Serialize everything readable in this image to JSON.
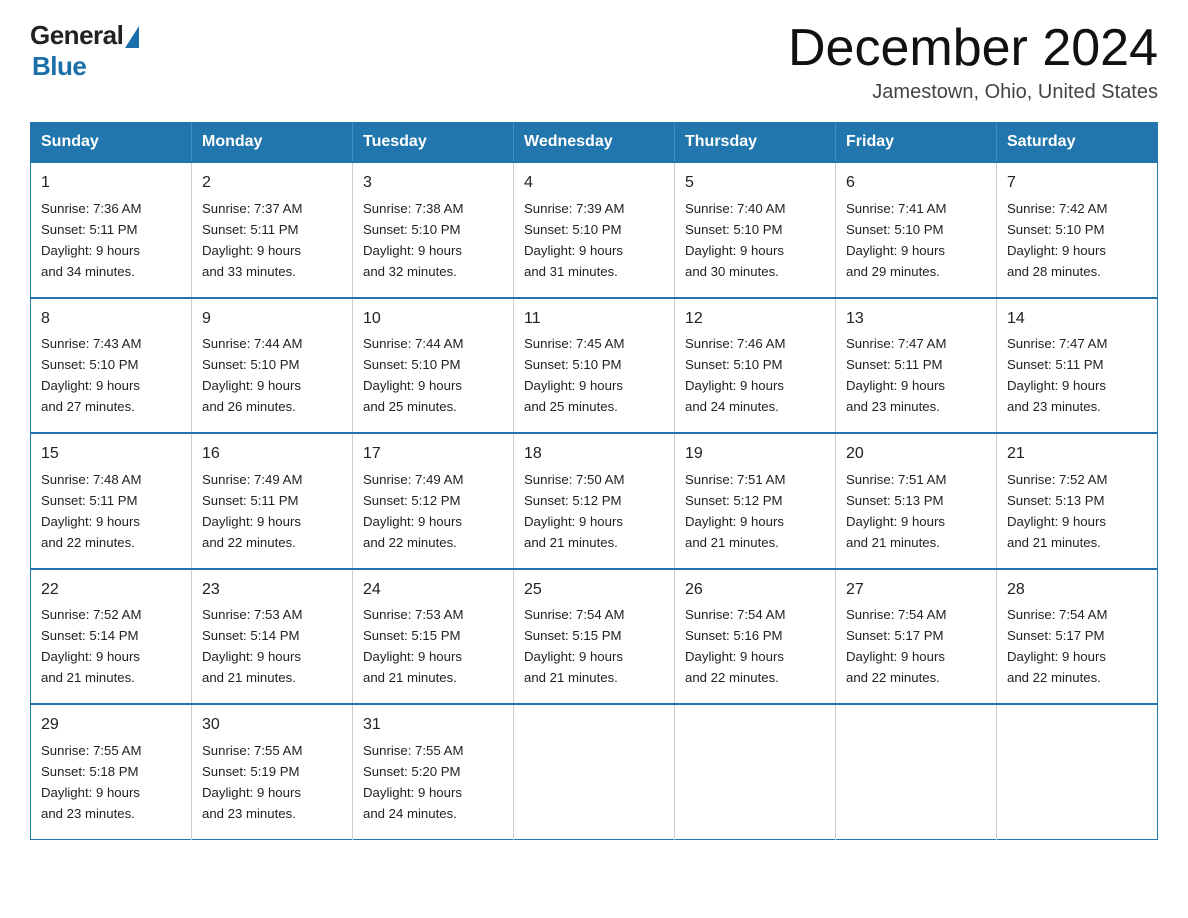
{
  "logo": {
    "general": "General",
    "blue": "Blue"
  },
  "header": {
    "month_title": "December 2024",
    "location": "Jamestown, Ohio, United States"
  },
  "days_of_week": [
    "Sunday",
    "Monday",
    "Tuesday",
    "Wednesday",
    "Thursday",
    "Friday",
    "Saturday"
  ],
  "weeks": [
    [
      {
        "day": "1",
        "sunrise": "7:36 AM",
        "sunset": "5:11 PM",
        "daylight": "9 hours and 34 minutes."
      },
      {
        "day": "2",
        "sunrise": "7:37 AM",
        "sunset": "5:11 PM",
        "daylight": "9 hours and 33 minutes."
      },
      {
        "day": "3",
        "sunrise": "7:38 AM",
        "sunset": "5:10 PM",
        "daylight": "9 hours and 32 minutes."
      },
      {
        "day": "4",
        "sunrise": "7:39 AM",
        "sunset": "5:10 PM",
        "daylight": "9 hours and 31 minutes."
      },
      {
        "day": "5",
        "sunrise": "7:40 AM",
        "sunset": "5:10 PM",
        "daylight": "9 hours and 30 minutes."
      },
      {
        "day": "6",
        "sunrise": "7:41 AM",
        "sunset": "5:10 PM",
        "daylight": "9 hours and 29 minutes."
      },
      {
        "day": "7",
        "sunrise": "7:42 AM",
        "sunset": "5:10 PM",
        "daylight": "9 hours and 28 minutes."
      }
    ],
    [
      {
        "day": "8",
        "sunrise": "7:43 AM",
        "sunset": "5:10 PM",
        "daylight": "9 hours and 27 minutes."
      },
      {
        "day": "9",
        "sunrise": "7:44 AM",
        "sunset": "5:10 PM",
        "daylight": "9 hours and 26 minutes."
      },
      {
        "day": "10",
        "sunrise": "7:44 AM",
        "sunset": "5:10 PM",
        "daylight": "9 hours and 25 minutes."
      },
      {
        "day": "11",
        "sunrise": "7:45 AM",
        "sunset": "5:10 PM",
        "daylight": "9 hours and 25 minutes."
      },
      {
        "day": "12",
        "sunrise": "7:46 AM",
        "sunset": "5:10 PM",
        "daylight": "9 hours and 24 minutes."
      },
      {
        "day": "13",
        "sunrise": "7:47 AM",
        "sunset": "5:11 PM",
        "daylight": "9 hours and 23 minutes."
      },
      {
        "day": "14",
        "sunrise": "7:47 AM",
        "sunset": "5:11 PM",
        "daylight": "9 hours and 23 minutes."
      }
    ],
    [
      {
        "day": "15",
        "sunrise": "7:48 AM",
        "sunset": "5:11 PM",
        "daylight": "9 hours and 22 minutes."
      },
      {
        "day": "16",
        "sunrise": "7:49 AM",
        "sunset": "5:11 PM",
        "daylight": "9 hours and 22 minutes."
      },
      {
        "day": "17",
        "sunrise": "7:49 AM",
        "sunset": "5:12 PM",
        "daylight": "9 hours and 22 minutes."
      },
      {
        "day": "18",
        "sunrise": "7:50 AM",
        "sunset": "5:12 PM",
        "daylight": "9 hours and 21 minutes."
      },
      {
        "day": "19",
        "sunrise": "7:51 AM",
        "sunset": "5:12 PM",
        "daylight": "9 hours and 21 minutes."
      },
      {
        "day": "20",
        "sunrise": "7:51 AM",
        "sunset": "5:13 PM",
        "daylight": "9 hours and 21 minutes."
      },
      {
        "day": "21",
        "sunrise": "7:52 AM",
        "sunset": "5:13 PM",
        "daylight": "9 hours and 21 minutes."
      }
    ],
    [
      {
        "day": "22",
        "sunrise": "7:52 AM",
        "sunset": "5:14 PM",
        "daylight": "9 hours and 21 minutes."
      },
      {
        "day": "23",
        "sunrise": "7:53 AM",
        "sunset": "5:14 PM",
        "daylight": "9 hours and 21 minutes."
      },
      {
        "day": "24",
        "sunrise": "7:53 AM",
        "sunset": "5:15 PM",
        "daylight": "9 hours and 21 minutes."
      },
      {
        "day": "25",
        "sunrise": "7:54 AM",
        "sunset": "5:15 PM",
        "daylight": "9 hours and 21 minutes."
      },
      {
        "day": "26",
        "sunrise": "7:54 AM",
        "sunset": "5:16 PM",
        "daylight": "9 hours and 22 minutes."
      },
      {
        "day": "27",
        "sunrise": "7:54 AM",
        "sunset": "5:17 PM",
        "daylight": "9 hours and 22 minutes."
      },
      {
        "day": "28",
        "sunrise": "7:54 AM",
        "sunset": "5:17 PM",
        "daylight": "9 hours and 22 minutes."
      }
    ],
    [
      {
        "day": "29",
        "sunrise": "7:55 AM",
        "sunset": "5:18 PM",
        "daylight": "9 hours and 23 minutes."
      },
      {
        "day": "30",
        "sunrise": "7:55 AM",
        "sunset": "5:19 PM",
        "daylight": "9 hours and 23 minutes."
      },
      {
        "day": "31",
        "sunrise": "7:55 AM",
        "sunset": "5:20 PM",
        "daylight": "9 hours and 24 minutes."
      },
      null,
      null,
      null,
      null
    ]
  ],
  "labels": {
    "sunrise_prefix": "Sunrise: ",
    "sunset_prefix": "Sunset: ",
    "daylight_prefix": "Daylight: "
  }
}
